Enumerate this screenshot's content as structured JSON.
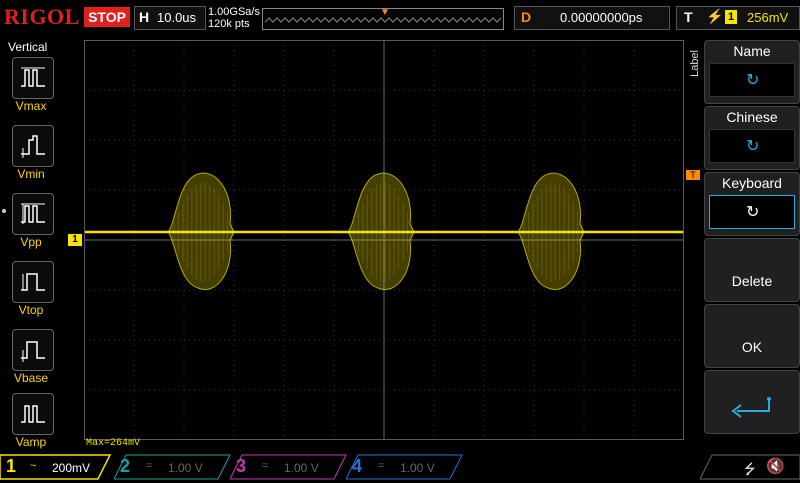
{
  "top": {
    "logo": "RIGOL",
    "run_status": "STOP",
    "h_letter": "H",
    "timebase": "10.0us",
    "sample_rate": "1.00GSa/s",
    "memory_depth": "120k pts",
    "d_letter": "D",
    "delay": "0.00000000ps",
    "t_letter": "T",
    "trigger_source": "1",
    "trigger_level": "256mV"
  },
  "left": {
    "title": "Vertical",
    "items": [
      {
        "label": "Vmax"
      },
      {
        "label": "Vmin"
      },
      {
        "label": "Vpp"
      },
      {
        "label": "Vtop"
      },
      {
        "label": "Vbase"
      },
      {
        "label": "Vamp"
      }
    ]
  },
  "screen": {
    "ch1_marker": "1",
    "trigger_marker": "T",
    "measurement": "Max=264mV"
  },
  "menu": {
    "side_label": "Label",
    "items": [
      {
        "label": "Name"
      },
      {
        "label": "Chinese"
      },
      {
        "label": "Keyboard"
      },
      {
        "label": "Delete"
      },
      {
        "label": "OK"
      },
      {
        "label": ""
      }
    ]
  },
  "channels": [
    {
      "num": "1",
      "coupling": "~",
      "scale": "200mV",
      "color": "#f5e300",
      "active": true
    },
    {
      "num": "2",
      "coupling": "=",
      "scale": "1.00 V",
      "color": "#1aa0a0",
      "active": false
    },
    {
      "num": "3",
      "coupling": "=",
      "scale": "1.00 V",
      "color": "#c03cb5",
      "active": false
    },
    {
      "num": "4",
      "coupling": "=",
      "scale": "1.00 V",
      "color": "#2a6fd6",
      "active": false
    }
  ],
  "colors": {
    "ch1": "#f5e300",
    "accent": "#2aa9e0",
    "trigger": "#ff8a00",
    "stop": "#e0201b"
  }
}
